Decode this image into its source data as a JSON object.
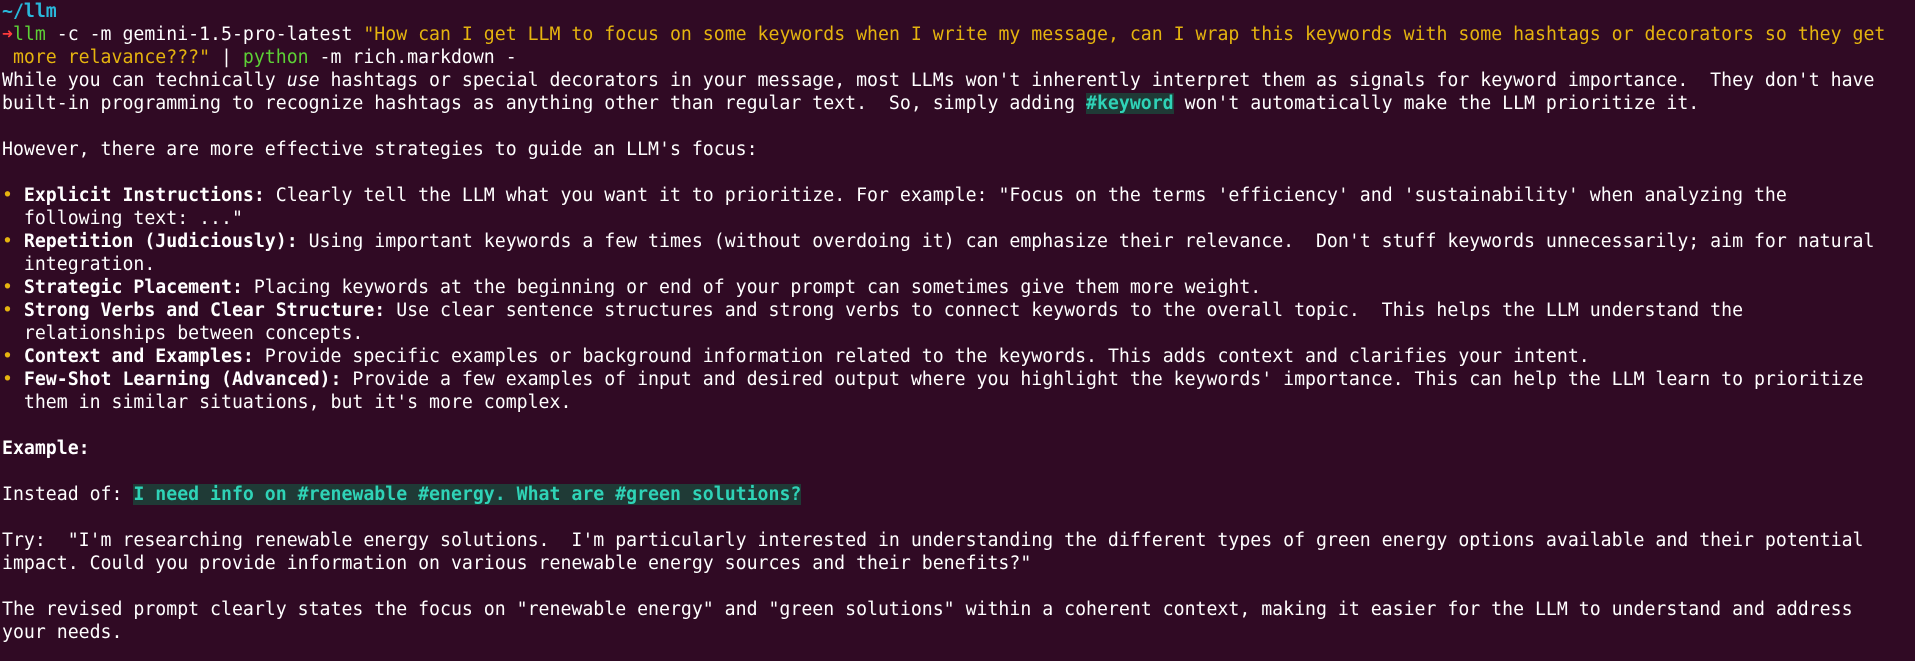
{
  "prompt": {
    "cwd": "~/llm",
    "arrow": "➜",
    "cmd": "llm",
    "args": " -c -m gemini-1.5-pro-latest ",
    "query_line1": "\"How can I get LLM to focus on some keywords when I write my message, can I wrap this keywords with some hashtags or decorators so they get",
    "query_line2": " more relavance???\"",
    "pipe": " | ",
    "pycmd": "python",
    "pyargs": " -m rich.markdown -"
  },
  "intro": {
    "l1a": "While you can technically ",
    "l1_em": "use",
    "l1b": " hashtags or special decorators in your message, most LLMs won't inherently interpret them as signals for keyword importance.  They don't have",
    "l2a": "built-in programming to recognize hashtags as anything other than regular text.  So, simply adding ",
    "l2_code": "#keyword",
    "l2b": " won't automatically make the LLM prioritize it."
  },
  "strategies_intro": "However, there are more effective strategies to guide an LLM's focus:",
  "bullet_char": "•",
  "bullets": [
    {
      "title": "Explicit Instructions:",
      "l1": " Clearly tell the LLM what you want it to prioritize. For example: \"Focus on the terms 'efficiency' and 'sustainability' when analyzing the",
      "l2": "following text: ...\""
    },
    {
      "title": "Repetition (Judiciously):",
      "l1": " Using important keywords a few times (without overdoing it) can emphasize their relevance.  Don't stuff keywords unnecessarily; aim for natural",
      "l2": "integration."
    },
    {
      "title": "Strategic Placement:",
      "l1": " Placing keywords at the beginning or end of your prompt can sometimes give them more weight.",
      "l2": ""
    },
    {
      "title": "Strong Verbs and Clear Structure:",
      "l1": " Use clear sentence structures and strong verbs to connect keywords to the overall topic.  This helps the LLM understand the",
      "l2": "relationships between concepts."
    },
    {
      "title": "Context and Examples:",
      "l1": " Provide specific examples or background information related to the keywords. This adds context and clarifies your intent.",
      "l2": ""
    },
    {
      "title": "Few-Shot Learning (Advanced):",
      "l1": " Provide a few examples of input and desired output where you highlight the keywords' importance. This can help the LLM learn to prioritize",
      "l2": "them in similar situations, but it's more complex."
    }
  ],
  "example_heading": "Example:",
  "instead": {
    "label": "Instead of: ",
    "code": "I need info on #renewable #energy. What are #green solutions?"
  },
  "try": {
    "l1": "Try:  \"I'm researching renewable energy solutions.  I'm particularly interested in understanding the different types of green energy options available and their potential",
    "l2": "impact. Could you provide information on various renewable energy sources and their benefits?\""
  },
  "conclusion": {
    "l1": "The revised prompt clearly states the focus on \"renewable energy\" and \"green solutions\" within a coherent context, making it easier for the LLM to understand and address",
    "l2": "your needs."
  },
  "colors": {
    "background": "#300a24",
    "directory": "#29b8db",
    "arrow": "#ff3b3b",
    "command": "#5dd136",
    "string": "#e5b40f",
    "inline_code": "#2fd3b7"
  }
}
